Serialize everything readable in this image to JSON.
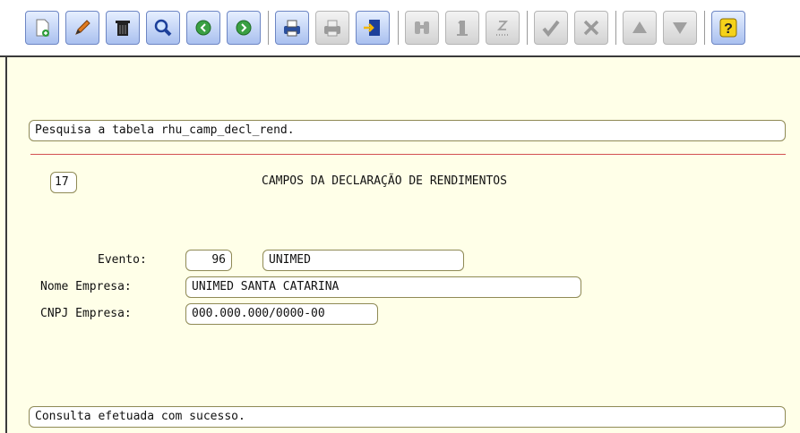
{
  "form": {
    "search_info": "Pesquisa a tabela rhu_camp_decl_rend.",
    "screen_code": "17",
    "screen_title": "CAMPOS DA DECLARAÇÃO DE RENDIMENTOS",
    "evento_label": "Evento:",
    "evento_code": "96",
    "evento_desc": "UNIMED",
    "nome_empresa_label": "Nome Empresa:",
    "nome_empresa_value": "UNIMED SANTA CATARINA",
    "cnpj_label": "CNPJ Empresa:",
    "cnpj_value": "000.000.000/0000-00"
  },
  "status": {
    "message": "Consulta efetuada com sucesso."
  },
  "colors": {
    "toolbar_active": "#a9c0ef",
    "toolbar_disabled": "#d2d2d2",
    "background": "#FFFFE8",
    "divider": "#d25050"
  },
  "toolbar_icons": [
    "new-document-icon",
    "pencil-icon",
    "trash-icon",
    "search-icon",
    "previous-icon",
    "next-icon",
    "print-icon",
    "print-disabled-icon",
    "exit-door-icon",
    "binoculars-icon",
    "first-record-icon",
    "last-record-icon",
    "confirm-icon",
    "cancel-icon",
    "scroll-up-icon",
    "scroll-down-icon",
    "help-icon"
  ]
}
